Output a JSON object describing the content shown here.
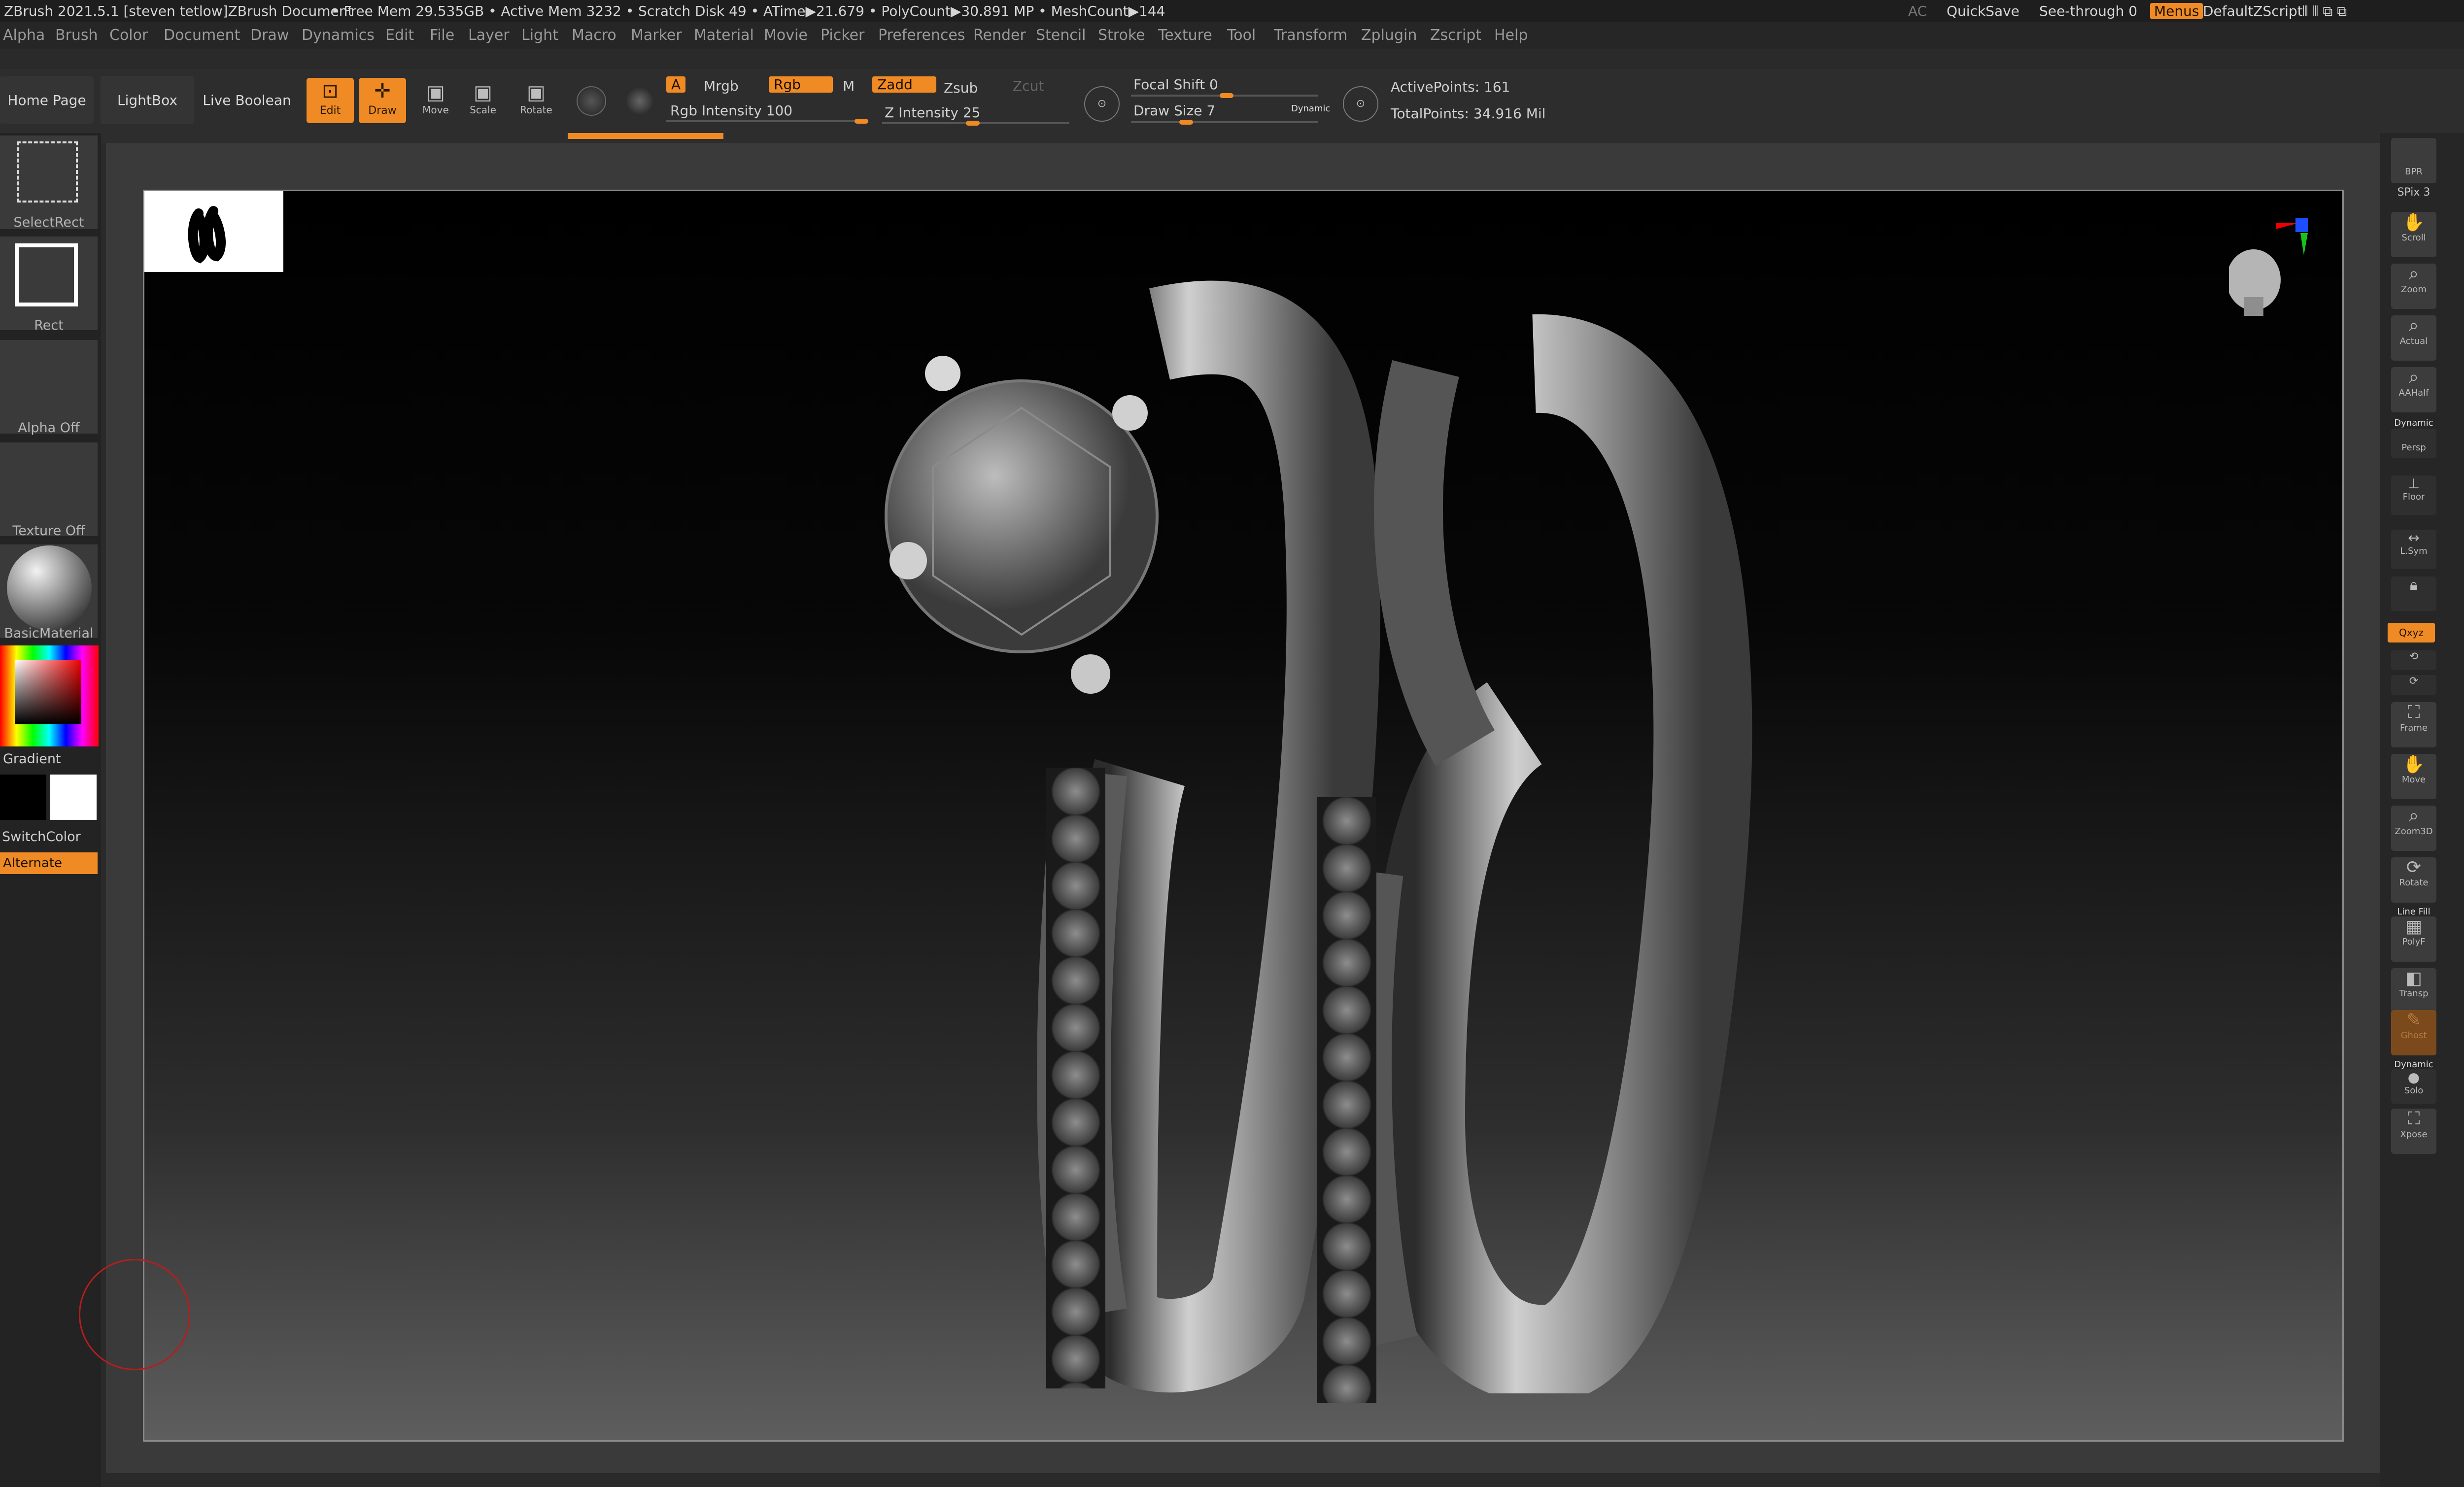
{
  "titlebar": {
    "app": "ZBrush 2021.5.1 [steven tetlow]ZBrush Document",
    "stats": "• Free Mem 29.535GB • Active Mem 3232 • Scratch Disk 49 •   ATime▶21.679 • PolyCount▶30.891 MP  • MeshCount▶144",
    "ac": "AC",
    "quicksave": "QuickSave",
    "seethrough": "See-through  0",
    "menus": "Menus",
    "script": "DefaultZScript"
  },
  "menu": [
    "Alpha",
    "Brush",
    "Color",
    "Document",
    "Draw",
    "Dynamics",
    "Edit",
    "File",
    "Layer",
    "Light",
    "Macro",
    "Marker",
    "Material",
    "Movie",
    "Picker",
    "Preferences",
    "Render",
    "Stencil",
    "Stroke",
    "Texture",
    "Tool",
    "Transform",
    "Zplugin",
    "Zscript",
    "Help"
  ],
  "shelf": {
    "home": "Home Page",
    "lightbox": "LightBox",
    "liveboolean": "Live Boolean",
    "edit": "Edit",
    "draw": "Draw",
    "move": "Move",
    "scale": "Scale",
    "rotate": "Rotate",
    "a": "A",
    "mrgb": "Mrgb",
    "rgb": "Rgb",
    "m": "M",
    "zadd": "Zadd",
    "zsub": "Zsub",
    "zcut": "Zcut",
    "rgb_intensity": "Rgb Intensity 100",
    "z_intensity": "Z Intensity 25",
    "focal_shift": "Focal Shift 0",
    "draw_size": "Draw Size 7",
    "dynamic": "Dynamic",
    "active_points": "ActivePoints: 161",
    "total_points": "TotalPoints: 34.916 Mil",
    "rgb_intensity_value": 100,
    "z_intensity_value": 25,
    "focal_shift_value": 0,
    "draw_size_value": 7
  },
  "left": {
    "selectrect": "SelectRect",
    "rect": "Rect",
    "alpha": "Alpha Off",
    "texture": "Texture Off",
    "material": "BasicMaterial",
    "gradient": "Gradient",
    "switchcolor": "SwitchColor",
    "alternate": "Alternate"
  },
  "right": {
    "bpr": "BPR",
    "spix": "SPix 3",
    "scroll": "Scroll",
    "zoom": "Zoom",
    "actual": "Actual",
    "aahalf": "AAHalf",
    "dynamic": "Dynamic",
    "persp": "Persp",
    "floor": "Floor",
    "lsym": "L.Sym",
    "xyz": "Qxyz",
    "frame": "Frame",
    "move": "Move",
    "zoom3d": "Zoom3D",
    "rotate": "Rotate",
    "linefill": "Line Fill",
    "polyf": "PolyF",
    "transp": "Transp",
    "ghost": "Ghost",
    "dynamic2": "Dynamic",
    "solo": "Solo",
    "xpose": "Xpose"
  },
  "colors": {
    "accent": "#f08a24",
    "background": "#2a2a2a"
  }
}
